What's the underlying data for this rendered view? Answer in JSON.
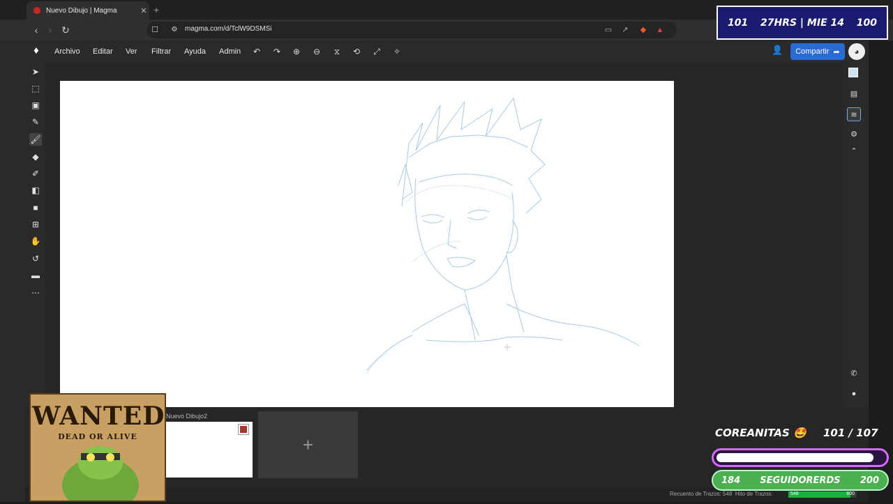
{
  "browser": {
    "tab_title": "Nuevo Dibujo | Magma",
    "tab_close": "✕",
    "new_tab": "+",
    "url": "magma.com/d/TclW9DSMSi"
  },
  "menu": {
    "items": [
      "Archivo",
      "Editar",
      "Ver",
      "Filtrar",
      "Ayuda",
      "Admin"
    ]
  },
  "share": {
    "label": "Compartir"
  },
  "drawings": {
    "thumb_label": "Nuevo Dibujo2",
    "add_label": "+"
  },
  "status": {
    "strokes_label": "Recuento de Trazos: 548",
    "milestone_label": "Hito de Trazos:",
    "strokes_value": "548",
    "milestone_value": "600",
    "progress_fraction": 0.913
  },
  "overlay_top": {
    "left": "101",
    "center": "27HRS | MIE 14",
    "right": "100"
  },
  "wanted": {
    "title": "WANTED",
    "subtitle": "DEAD OR ALIVE"
  },
  "goal": {
    "title": "COREANITAS 🤩",
    "count": "101 / 107",
    "progress_fraction": 0.94
  },
  "followers": {
    "left": "184",
    "label": "SEGUIDORERDS",
    "right": "200"
  },
  "colors": {
    "accent": "#2a6bd3",
    "sketch": "#9ec4e0"
  }
}
